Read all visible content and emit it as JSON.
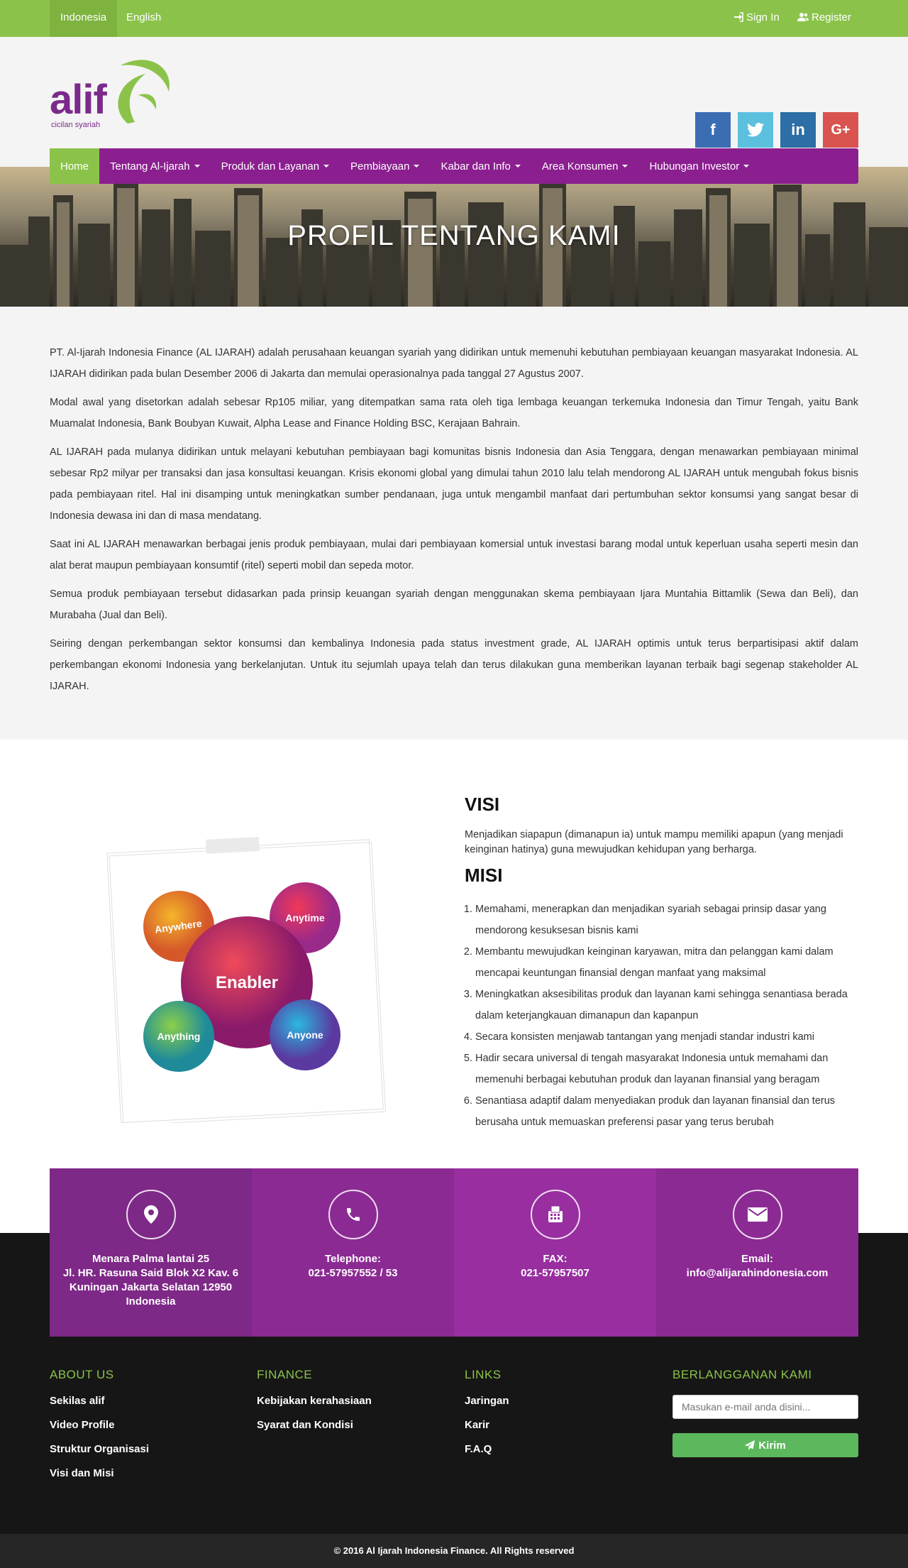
{
  "topbar": {
    "languages": [
      "Indonesia",
      "English"
    ],
    "sign_in": "Sign In",
    "register": "Register"
  },
  "header": {
    "logo_text": "alif",
    "logo_tagline": "cicilan syariah",
    "social": [
      "facebook",
      "twitter",
      "linkedin",
      "google-plus"
    ],
    "colors": {
      "facebook": "#3b6db3",
      "twitter": "#5bc0de",
      "linkedin": "#2c6ea5",
      "google": "#d9534f"
    }
  },
  "nav": {
    "items": [
      {
        "label": "Home",
        "dropdown": false,
        "active": true
      },
      {
        "label": "Tentang Al-Ijarah",
        "dropdown": true
      },
      {
        "label": "Produk dan Layanan",
        "dropdown": true
      },
      {
        "label": "Pembiayaan",
        "dropdown": true
      },
      {
        "label": "Kabar dan Info",
        "dropdown": true
      },
      {
        "label": "Area Konsumen",
        "dropdown": true
      },
      {
        "label": "Hubungan Investor",
        "dropdown": true
      }
    ]
  },
  "hero": {
    "title": "PROFIL TENTANG KAMI"
  },
  "about": {
    "paragraphs": [
      "PT. Al-Ijarah Indonesia Finance (AL IJARAH) adalah perusahaan keuangan syariah yang didirikan untuk memenuhi kebutuhan pembiayaan keuangan masyarakat Indonesia. AL IJARAH didirikan pada bulan Desember 2006 di Jakarta dan memulai operasionalnya pada tanggal 27 Agustus 2007.",
      "Modal awal yang disetorkan adalah sebesar Rp105 miliar, yang ditempatkan sama rata oleh tiga lembaga keuangan terkemuka Indonesia dan Timur Tengah, yaitu Bank Muamalat Indonesia, Bank Boubyan Kuwait, Alpha Lease and Finance Holding BSC, Kerajaan Bahrain.",
      "AL IJARAH pada mulanya didirikan untuk melayani kebutuhan pembiayaan bagi komunitas bisnis Indonesia dan Asia Tenggara, dengan menawarkan pembiayaan minimal sebesar Rp2 milyar per transaksi dan jasa konsultasi keuangan. Krisis ekonomi global yang dimulai tahun 2010 lalu telah mendorong AL IJARAH untuk mengubah fokus bisnis pada pembiayaan ritel. Hal ini disamping untuk meningkatkan sumber pendanaan, juga untuk mengambil manfaat dari pertumbuhan sektor konsumsi yang sangat besar di Indonesia dewasa ini dan di masa mendatang.",
      "Saat ini AL IJARAH menawarkan berbagai jenis produk pembiayaan, mulai dari pembiayaan komersial untuk investasi barang modal untuk keperluan usaha seperti mesin dan alat berat maupun pembiayaan konsumtif (ritel) seperti mobil dan sepeda motor.",
      "Semua produk pembiayaan tersebut didasarkan pada prinsip keuangan syariah dengan menggunakan skema pembiayaan Ijara Muntahia Bittamlik (Sewa dan Beli), dan Murabaha (Jual dan Beli).",
      "Seiring dengan perkembangan sektor konsumsi dan kembalinya Indonesia pada status investment grade, AL IJARAH optimis untuk terus berpartisipasi aktif dalam perkembangan ekonomi Indonesia yang berkelanjutan. Untuk itu sejumlah upaya telah dan terus dilakukan guna memberikan layanan terbaik bagi segenap stakeholder AL IJARAH."
    ]
  },
  "visi": {
    "heading": "VISI",
    "text": "Menjadikan siapapun (dimanapun ia) untuk mampu memiliki apapun (yang menjadi keinginan hatinya) guna mewujudkan kehidupan yang berharga.",
    "image": {
      "center": "Enabler",
      "bubbles": [
        "Anywhere",
        "Anytime",
        "Anything",
        "Anyone"
      ]
    }
  },
  "misi": {
    "heading": "MISI",
    "items": [
      "Memahami, menerapkan dan menjadikan syariah sebagai prinsip dasar yang mendorong kesuksesan bisnis kami",
      "Membantu mewujudkan keinginan karyawan, mitra dan pelanggan kami dalam mencapai keuntungan finansial dengan manfaat yang maksimal",
      "Meningkatkan aksesibilitas produk dan layanan kami sehingga senantiasa berada dalam keterjangkauan dimanapun dan kapanpun",
      "Secara konsisten menjawab tantangan yang menjadi standar industri kami",
      "Hadir secara universal di tengah masyarakat Indonesia untuk memahami dan memenuhi berbagai kebutuhan produk dan layanan finansial yang beragam",
      "Senantiasa adaptif dalam menyediakan produk dan layanan finansial dan terus berusaha untuk memuaskan preferensi pasar yang terus berubah"
    ]
  },
  "contact": {
    "address": [
      "Menara Palma lantai 25",
      "Jl. HR. Rasuna Said Blok X2 Kav. 6",
      "Kuningan Jakarta Selatan 12950",
      "Indonesia"
    ],
    "telephone_label": "Telephone:",
    "telephone": "021-57957552 / 53",
    "fax_label": "FAX:",
    "fax": "021-57957507",
    "email_label": "Email:",
    "email": "info@alijarahindonesia.com",
    "colors": [
      "#7e2887",
      "#8c2a94",
      "#982ea0",
      "#8c2a94"
    ]
  },
  "footer": {
    "about_heading": "ABOUT US",
    "about_links": [
      "Sekilas alif",
      "Video Profile",
      "Struktur Organisasi",
      "Visi dan Misi"
    ],
    "finance_heading": "FINANCE",
    "finance_links": [
      "Kebijakan kerahasiaan",
      "Syarat dan Kondisi"
    ],
    "links_heading": "LINKS",
    "links": [
      "Jaringan",
      "Karir",
      "F.A.Q"
    ],
    "subscribe_heading": "BERLANGGANAN KAMI",
    "subscribe_placeholder": "Masukan e-mail anda disini...",
    "subscribe_button": "Kirim",
    "copyright": "© 2016 Al Ijarah Indonesia Finance. All Rights reserved"
  }
}
